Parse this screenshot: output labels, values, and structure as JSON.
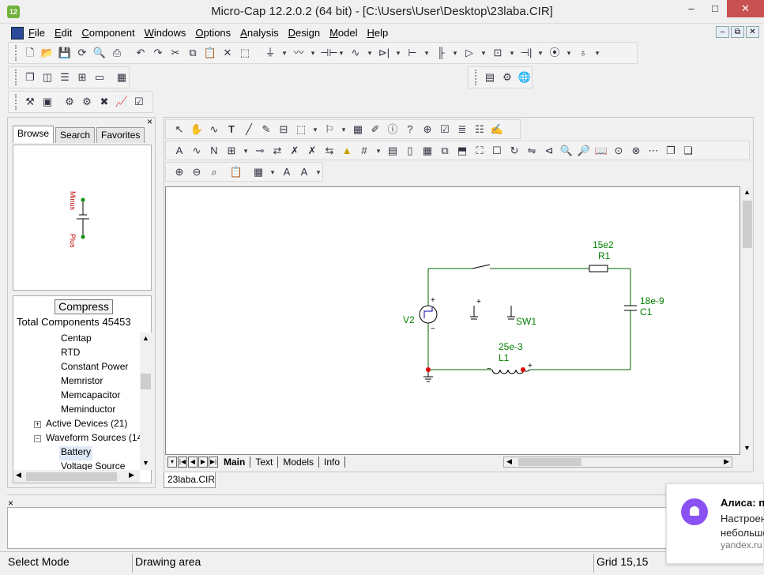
{
  "window": {
    "title": "Micro-Cap 12.2.0.2 (64 bit) - [C:\\Users\\User\\Desktop\\23laba.CIR]",
    "app_icon_label": "12",
    "controls": {
      "minimize": "–",
      "maximize": "□",
      "close": "✕"
    }
  },
  "menubar": {
    "items": [
      "File",
      "Edit",
      "Component",
      "Windows",
      "Options",
      "Analysis",
      "Design",
      "Model",
      "Help"
    ],
    "mdi_buttons": [
      "–",
      "⧉",
      "✕"
    ]
  },
  "left_panel": {
    "close": "×",
    "tabs": [
      "Browse",
      "Search",
      "Favorites"
    ],
    "active_tab": "Browse",
    "preview": {
      "labels": [
        "Minus",
        "Plus"
      ]
    },
    "compress_label": "Compress",
    "total_components": "Total Components 45453",
    "tree": [
      {
        "label": "Centap",
        "level": 2
      },
      {
        "label": "RTD",
        "level": 2
      },
      {
        "label": "Constant Power",
        "level": 2
      },
      {
        "label": "Memristor",
        "level": 2
      },
      {
        "label": "Memcapacitor",
        "level": 2
      },
      {
        "label": "Meminductor",
        "level": 2
      },
      {
        "label": "Active Devices (21)",
        "level": 1,
        "expander": "+"
      },
      {
        "label": "Waveform Sources (14",
        "level": 1,
        "expander": "−"
      },
      {
        "label": "Battery",
        "level": 2,
        "selected": true
      },
      {
        "label": "Voltage Source",
        "level": 2
      }
    ]
  },
  "schematic": {
    "components": {
      "r1_value": "15e2",
      "r1_name": "R1",
      "c1_value": "18e-9",
      "c1_name": "C1",
      "v2_name": "V2",
      "sw1_name": "SW1",
      "l1_value": "25e-3",
      "l1_name": "L1",
      "plus": "+",
      "minus": "−"
    },
    "tabs": [
      "Main",
      "Text",
      "Models",
      "Info"
    ],
    "active_tab": "Main",
    "file_tab": "23laba.CIR",
    "wire_color": "#006400",
    "label_color": "#008000"
  },
  "output_pane": {
    "close": "×"
  },
  "statusbar": {
    "mode": "Select Mode",
    "area": "Drawing area",
    "grid": "Grid 15,15"
  },
  "notification": {
    "title": "Алиса: п",
    "body_line1": "Настроен",
    "body_line2": "небольшо",
    "source": "yandex.ru",
    "icon_color": "#8a52f2"
  }
}
